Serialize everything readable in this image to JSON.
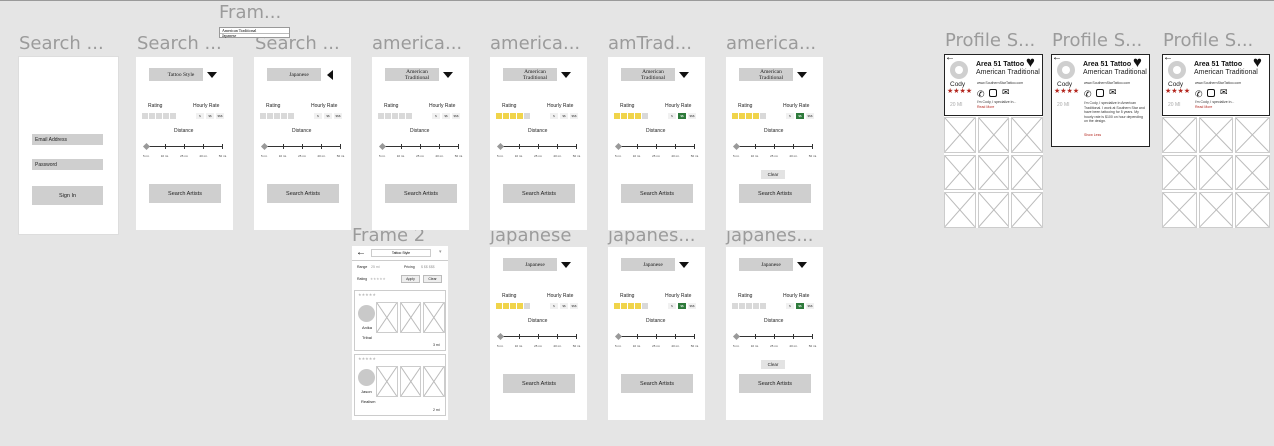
{
  "frame_labels": {
    "search_login": "Search ...",
    "search_tattoo": "Search ...",
    "frame_top": "Fram...",
    "search_japanese": "Search ...",
    "american1": "america...",
    "american2": "america...",
    "amtrad": "amTrad...",
    "american3": "america...",
    "frame2": "Frame 2",
    "japanese": "japanese",
    "japanes2": "japanes...",
    "japanes3": "japanes...",
    "profile1": "Profile S...",
    "profile2": "Profile S...",
    "profile3": "Profile S..."
  },
  "top_menu": {
    "item1": "American Traditional",
    "item2": "Japanese"
  },
  "login": {
    "email": "Email Address",
    "password": "Password",
    "signin": "Sign In"
  },
  "search": {
    "rating": "Rating",
    "hourly_rate": "Hourly Rate",
    "distance": "Distance",
    "search_button": "Search Artists",
    "clear": "Clear",
    "rate_options": [
      "$",
      "$$",
      "$$$"
    ],
    "distance_scale": [
      "5 mi.",
      "10 mi.",
      "25 mi.",
      "40 mi.",
      "50 mi."
    ],
    "styles": {
      "tattoo": "Tattoo Style",
      "japanese": "Japanese",
      "american": "American Traditional"
    }
  },
  "frame2": {
    "style": "Tattoo Style",
    "range": "Range",
    "range_val": "25 mi",
    "pricing": "Pricing",
    "pricing_vals": "$ $$ $$$",
    "rating": "Rating",
    "apply": "Apply",
    "clear": "Clear",
    "artist1": {
      "name": "Anika",
      "style": "Tribal",
      "dist": "3 mi"
    },
    "artist2": {
      "name": "Jason",
      "style": "Realism",
      "dist": "2 mi"
    }
  },
  "profile": {
    "shop": "Area 51 Tattoo",
    "style": "American Traditional",
    "artist": "Cody",
    "stars": "★★★★",
    "dist": "20 MI",
    "site": "www.SouthernStarTattoo.com",
    "bio_short": "I'm Cody, I specialize in...",
    "read_more": "Read More",
    "bio_long": "I'm Cody, I specialize in American Traditional. I work at Southern Star and have been tattooing for 5 years. My hourly rate is $100 on hour depending on the design.",
    "show_less": "Show Less"
  },
  "colors": {
    "bg": "#e5e5e5",
    "frame": "#ffffff",
    "control": "#cfcfcf",
    "star_on": "#f0d44a",
    "price_on": "#2d7a3a",
    "accent": "#b3261e"
  }
}
